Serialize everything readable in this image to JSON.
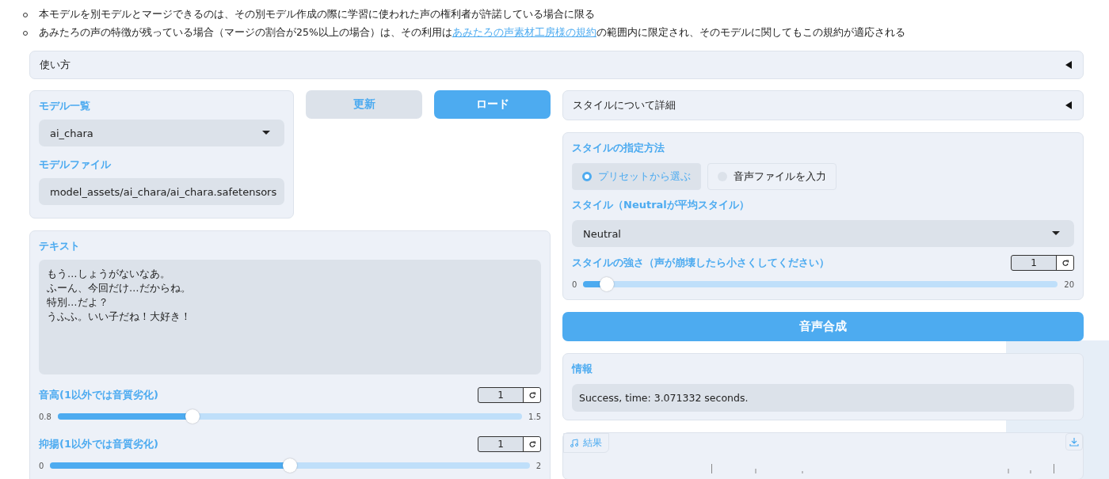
{
  "notes": [
    {
      "text": "本モデルを別モデルとマージできるのは、その別モデル作成の際に学習に使われた声の権利者が許諾している場合に限る"
    },
    {
      "text": "あみたろの声の特徴が残っている場合（マージの割合が25%以上の場合）は、その利用は",
      "link": "あみたろの声素材工房様の規約",
      "after": "の範囲内に限定され、そのモデルに関してもこの規約が適応される"
    }
  ],
  "usage_accordion": {
    "label": "使い方",
    "expanded": false
  },
  "model_panel": {
    "fields": [
      {
        "label": "モデル一覧",
        "value": "ai_chara"
      },
      {
        "label": "モデルファイル",
        "value": "model_assets/ai_chara/ai_chara.safetensors"
      }
    ]
  },
  "buttons": [
    {
      "label": "更新",
      "kind": "secondary"
    },
    {
      "label": "ロード",
      "kind": "primary"
    }
  ],
  "text_panel": {
    "label": "テキスト",
    "lines": [
      "もう…しょうがないなあ。",
      "ふーん、今回だけ…だからね。",
      "特別…だよ？",
      "うふふ。いい子だね！大好き！"
    ]
  },
  "left_sliders": [
    {
      "label": "音高(1以外では音質劣化)",
      "value": "1",
      "min": "0.8",
      "max": "1.5",
      "level": 0.29
    },
    {
      "label": "抑揚(1以外では音質劣化)",
      "value": "1",
      "min": "0",
      "max": "2",
      "level": 0.5
    }
  ],
  "style_accordion": {
    "label": "スタイルについて詳細",
    "expanded": false
  },
  "style_panel": {
    "method_label": "スタイルの指定方法",
    "options": [
      {
        "label": "プリセットから選ぶ",
        "selected": true
      },
      {
        "label": "音声ファイルを入力",
        "selected": false
      }
    ],
    "style_label": "スタイル（Neutralが平均スタイル）",
    "style_value": "Neutral",
    "strength": {
      "label": "スタイルの強さ（声が崩壊したら小さくしてください）",
      "value": "1",
      "min": "0",
      "max": "20",
      "level": 0.05
    }
  },
  "synth_button": {
    "label": "音声合成"
  },
  "info": {
    "label": "情報",
    "value": "Success, time: 3.071332 seconds."
  },
  "result": {
    "label": "結果"
  }
}
